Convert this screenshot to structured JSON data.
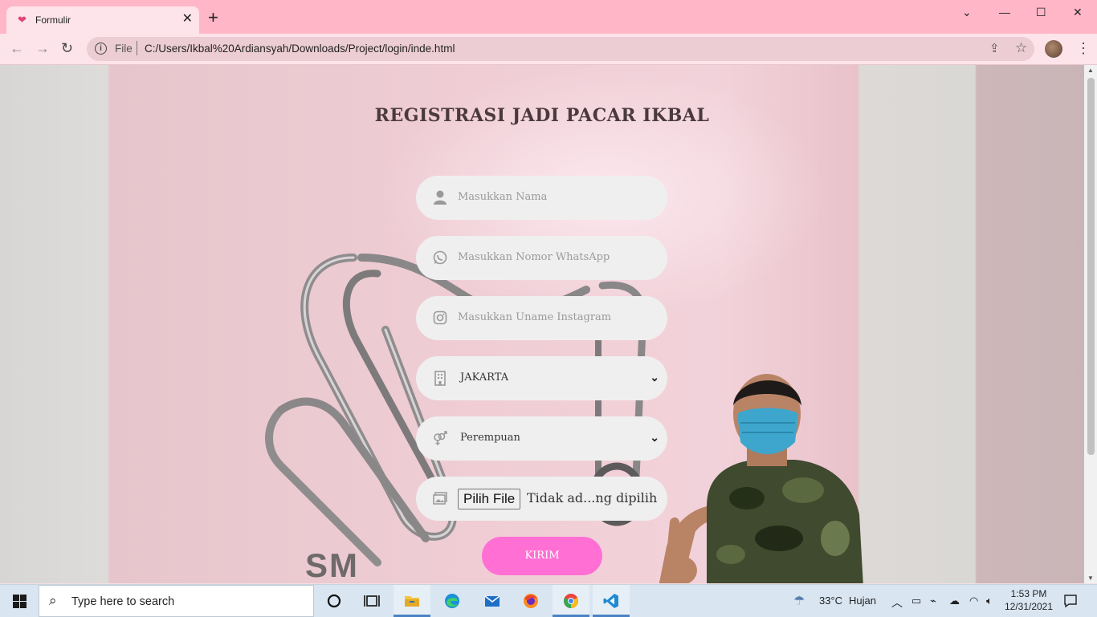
{
  "browser": {
    "tab_title": "Formulir",
    "tab_close": "✕",
    "new_tab": "+",
    "url_scheme": "File",
    "url": "C:/Users/Ikbal%20Ardiansyah/Downloads/Project/login/inde.html"
  },
  "page": {
    "title": "REGISTRASI JADI PACAR IKBAL",
    "fields": {
      "name_placeholder": "Masukkan Nama",
      "whatsapp_placeholder": "Masukkan Nomor WhatsApp",
      "instagram_placeholder": "Masukkan Uname Instagram",
      "city_value": "JAKARTA",
      "gender_value": "Perempuan",
      "file_button": "Pilih File",
      "file_status": "Tidak ad...ng dipilih"
    },
    "submit_label": "KIRIM",
    "sign_text": "SM"
  },
  "taskbar": {
    "search_placeholder": "Type here to search",
    "weather_temp": "33°C",
    "weather_text": "Hujan",
    "time": "1:53 PM",
    "date": "12/31/2021"
  },
  "colors": {
    "tabbar": "#ffb6c6",
    "submit": "#ff6fd4"
  }
}
